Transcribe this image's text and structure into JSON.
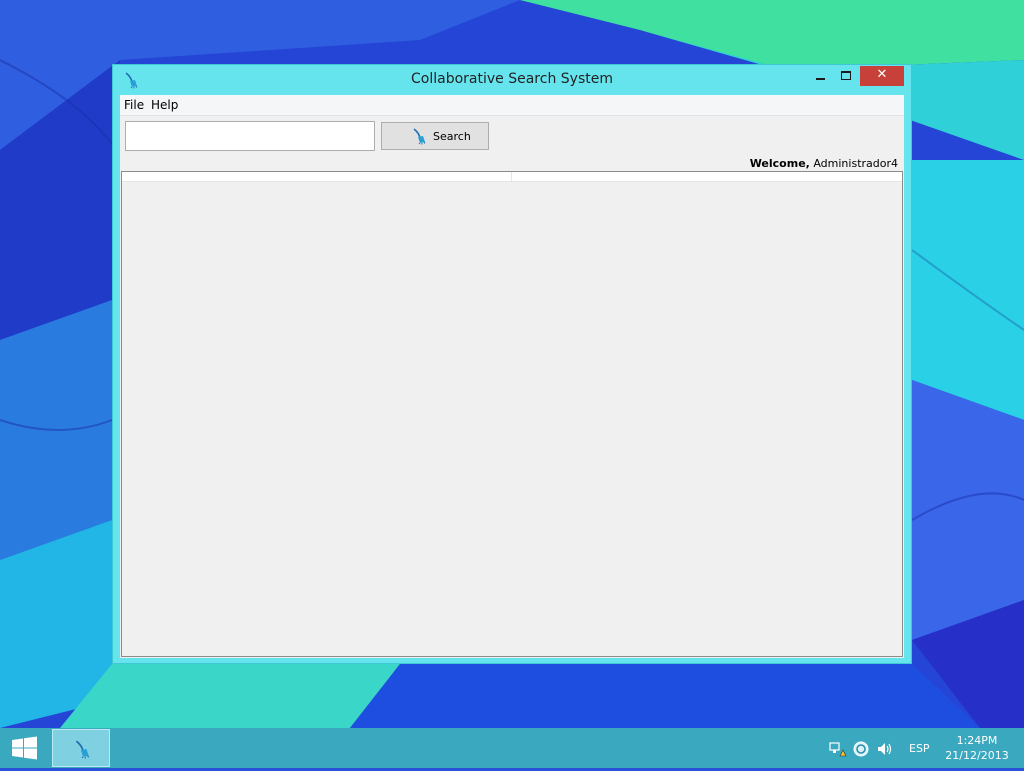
{
  "window": {
    "title": "Collaborative Search System"
  },
  "menu": {
    "file": "File",
    "help": "Help"
  },
  "search": {
    "value": "",
    "placeholder": "",
    "button_label": "Search"
  },
  "welcome": {
    "prefix": "Welcome,",
    "user": "Administrador4"
  },
  "results": {
    "columns": [
      "",
      ""
    ]
  },
  "taskbar": {
    "language": "ESP",
    "time": "1:24PM",
    "date": "21/12/2013"
  },
  "icons": {
    "app": "broom-search-icon",
    "start": "windows-logo-icon",
    "network": "network-warning-icon",
    "sync": "sync-icon",
    "volume": "speaker-icon"
  },
  "colors": {
    "titlebar": "#66e4ee",
    "close_button": "#c7403a",
    "taskbar": "#3aa8bf",
    "desktop": "#2a4fd8"
  }
}
